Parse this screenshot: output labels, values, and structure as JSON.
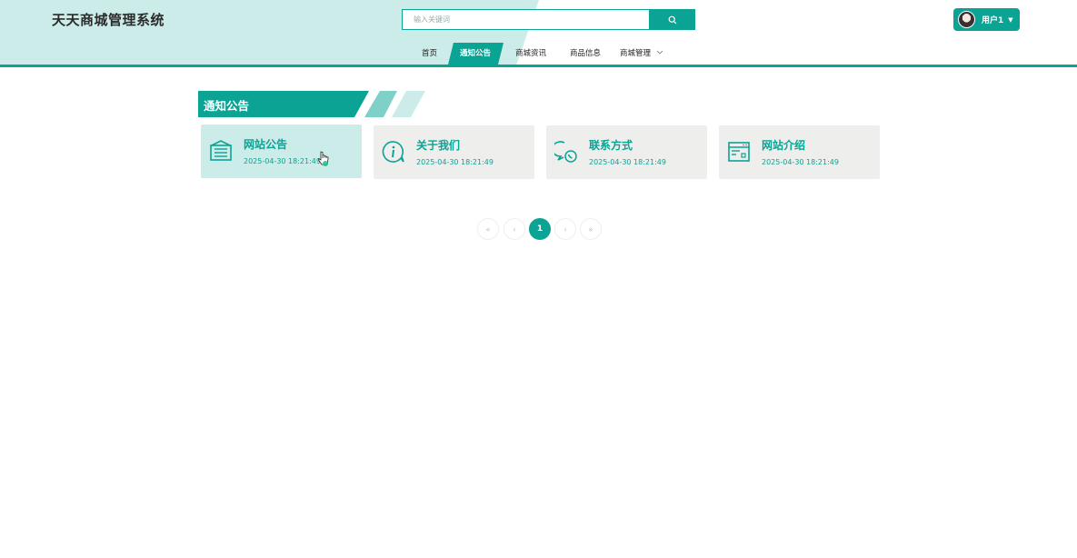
{
  "app": {
    "title": "天天商城管理系统"
  },
  "search": {
    "placeholder": "输入关键词",
    "button_icon": "search-icon"
  },
  "user": {
    "name": "用户1",
    "avatar_icon": "avatar"
  },
  "nav": {
    "items": [
      {
        "label": "首页",
        "active": false
      },
      {
        "label": "通知公告",
        "active": true
      },
      {
        "label": "商城资讯",
        "active": false
      },
      {
        "label": "商品信息",
        "active": false
      },
      {
        "label": "商城管理",
        "active": false,
        "has_dropdown": true
      }
    ]
  },
  "section": {
    "title": "通知公告"
  },
  "cards": [
    {
      "title": "网站公告",
      "date": "2025-04-30 18:21:49",
      "icon": "newspaper-icon",
      "hovered": true
    },
    {
      "title": "关于我们",
      "date": "2025-04-30 18:21:49",
      "icon": "info-chat-icon",
      "hovered": false
    },
    {
      "title": "联系方式",
      "date": "2025-04-30 18:21:49",
      "icon": "phone-chat-icon",
      "hovered": false
    },
    {
      "title": "网站介绍",
      "date": "2025-04-30 18:21:49",
      "icon": "browser-window-icon",
      "hovered": false
    }
  ],
  "pagination": {
    "first": "«",
    "prev": "‹",
    "current": "1",
    "next": "›",
    "last": "»"
  },
  "colors": {
    "accent": "#0aa394",
    "header_light": "#cbece9",
    "card_bg": "#eeeeec",
    "card_hover": "#cbece9"
  }
}
